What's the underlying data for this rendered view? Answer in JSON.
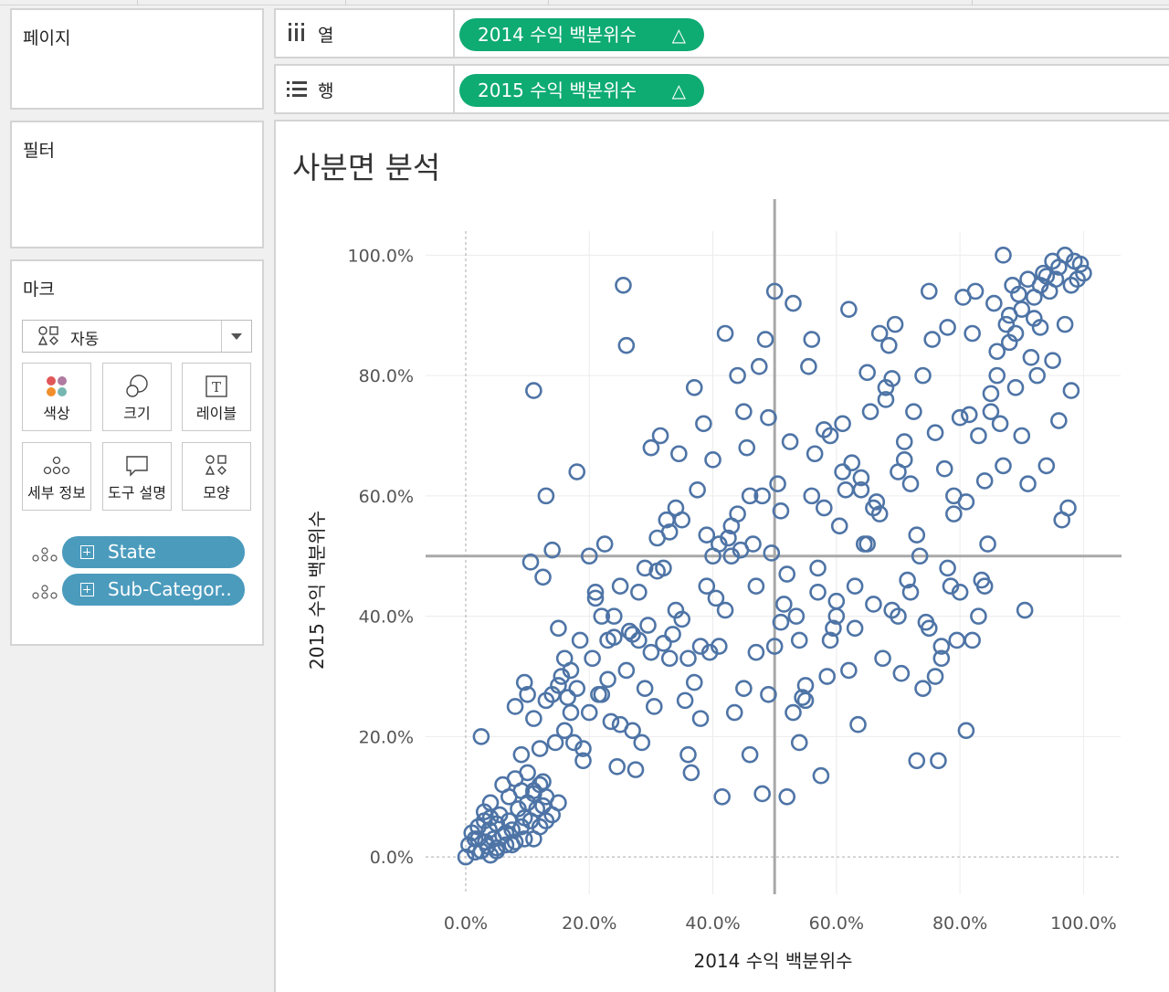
{
  "panels": {
    "pages": "페이지",
    "filters": "필터",
    "marks": "마크"
  },
  "marks": {
    "type_selected": "자동",
    "buttons": [
      "색상",
      "크기",
      "레이블",
      "세부 정보",
      "도구 설명",
      "모양"
    ],
    "fields": [
      "State",
      "Sub-Categor.."
    ]
  },
  "shelves": {
    "columns": {
      "label": "열",
      "pill": "2014 수익 백분위수",
      "delta": "△"
    },
    "rows": {
      "label": "행",
      "pill": "2015 수익 백분위수",
      "delta": "△"
    }
  },
  "colors": {
    "point": "#4e74a6",
    "pill_green": "#0eab73",
    "pill_blue": "#4b9bbd"
  },
  "chart_data": {
    "type": "scatter",
    "title": "사분면 분석",
    "xlabel": "2014 수익 백분위수",
    "ylabel": "2015 수익 백분위수",
    "xlim": [
      -6.5,
      106
    ],
    "ylim": [
      -6.2,
      104
    ],
    "xticks": [
      "0.0%",
      "20.0%",
      "40.0%",
      "60.0%",
      "80.0%",
      "100.0%"
    ],
    "yticks": [
      "0.0%",
      "20.0%",
      "40.0%",
      "60.0%",
      "80.0%",
      "100.0%"
    ],
    "reference_lines": {
      "x": 50,
      "y": 50
    },
    "marker": "open-circle",
    "grid": true,
    "points": [
      [
        0,
        0
      ],
      [
        0.5,
        2
      ],
      [
        1,
        4
      ],
      [
        1.5,
        3
      ],
      [
        2,
        5
      ],
      [
        2.5,
        1
      ],
      [
        3,
        6
      ],
      [
        3.2,
        2.5
      ],
      [
        3.8,
        4.5
      ],
      [
        4,
        0.3
      ],
      [
        4.5,
        3
      ],
      [
        5,
        5.5
      ],
      [
        5,
        1.5
      ],
      [
        5.5,
        7
      ],
      [
        6,
        3.5
      ],
      [
        6.5,
        2
      ],
      [
        7,
        6
      ],
      [
        7.5,
        4.5
      ],
      [
        8,
        2.5
      ],
      [
        8.5,
        8
      ],
      [
        9,
        5
      ],
      [
        9.5,
        3
      ],
      [
        10,
        9
      ],
      [
        10.5,
        6
      ],
      [
        11,
        11
      ],
      [
        11.5,
        8
      ],
      [
        12,
        5
      ],
      [
        12.5,
        12.5
      ],
      [
        13,
        10
      ],
      [
        14,
        7
      ],
      [
        15,
        9
      ],
      [
        5,
        1
      ],
      [
        2,
        3
      ],
      [
        3,
        7.5
      ],
      [
        4,
        9
      ],
      [
        6,
        12
      ],
      [
        7,
        10
      ],
      [
        8,
        13
      ],
      [
        9,
        11
      ],
      [
        10,
        14
      ],
      [
        11,
        10.5
      ],
      [
        12,
        12
      ],
      [
        12.5,
        8.5
      ],
      [
        13,
        6
      ],
      [
        2.5,
        20
      ],
      [
        4,
        6.5
      ],
      [
        6.5,
        4
      ],
      [
        7.5,
        2
      ],
      [
        9.5,
        6.5
      ],
      [
        11,
        3
      ],
      [
        1.5,
        0.8
      ],
      [
        3.5,
        1.8
      ],
      [
        9.5,
        29
      ],
      [
        10.5,
        49
      ],
      [
        11,
        77.5
      ],
      [
        12.5,
        46.5
      ],
      [
        13,
        60
      ],
      [
        14,
        27
      ],
      [
        14.5,
        19
      ],
      [
        15,
        28.5
      ],
      [
        15.5,
        30
      ],
      [
        16,
        21
      ],
      [
        16.5,
        26.5
      ],
      [
        17,
        31
      ],
      [
        17.5,
        19
      ],
      [
        18,
        28
      ],
      [
        18.5,
        36
      ],
      [
        19,
        18
      ],
      [
        20,
        24
      ],
      [
        20.5,
        33
      ],
      [
        21,
        44
      ],
      [
        21.5,
        27
      ],
      [
        22,
        40
      ],
      [
        22.5,
        52
      ],
      [
        23,
        29.5
      ],
      [
        23.5,
        22.5
      ],
      [
        24,
        36.5
      ],
      [
        24.5,
        15
      ],
      [
        25,
        45
      ],
      [
        25.5,
        95
      ],
      [
        26,
        85
      ],
      [
        26.5,
        37.5
      ],
      [
        27,
        37
      ],
      [
        27.5,
        14.5
      ],
      [
        28,
        44
      ],
      [
        28.5,
        19
      ],
      [
        29,
        28
      ],
      [
        29.5,
        38.5
      ],
      [
        30,
        68
      ],
      [
        30.5,
        25
      ],
      [
        31,
        47.5
      ],
      [
        31.5,
        70
      ],
      [
        32,
        35.5
      ],
      [
        32.5,
        56
      ],
      [
        33,
        33
      ],
      [
        33.5,
        37
      ],
      [
        34,
        58
      ],
      [
        34.5,
        67
      ],
      [
        35,
        39.5
      ],
      [
        35.5,
        26
      ],
      [
        36,
        33
      ],
      [
        36.5,
        14
      ],
      [
        37,
        78
      ],
      [
        37.5,
        61
      ],
      [
        38,
        23
      ],
      [
        38.5,
        72
      ],
      [
        39,
        53.5
      ],
      [
        39.5,
        34
      ],
      [
        40,
        66
      ],
      [
        40.5,
        43
      ],
      [
        41,
        35
      ],
      [
        41.5,
        10
      ],
      [
        42,
        87
      ],
      [
        42.5,
        53
      ],
      [
        43,
        55
      ],
      [
        43.5,
        24
      ],
      [
        44,
        80
      ],
      [
        44.5,
        51
      ],
      [
        45,
        74
      ],
      [
        45.5,
        68
      ],
      [
        46,
        60
      ],
      [
        46.5,
        52
      ],
      [
        47,
        34
      ],
      [
        47.5,
        81.5
      ],
      [
        48,
        10.5
      ],
      [
        48.5,
        86
      ],
      [
        49,
        73
      ],
      [
        49.5,
        50.5
      ],
      [
        50,
        94
      ],
      [
        50.5,
        62
      ],
      [
        51,
        57.5
      ],
      [
        51.5,
        42
      ],
      [
        52,
        47
      ],
      [
        52.5,
        69
      ],
      [
        53,
        92
      ],
      [
        53.5,
        40
      ],
      [
        54,
        36
      ],
      [
        54.5,
        26.5
      ],
      [
        55,
        28.5
      ],
      [
        55.5,
        81.5
      ],
      [
        56,
        60
      ],
      [
        56.5,
        67
      ],
      [
        57,
        44
      ],
      [
        57.5,
        13.5
      ],
      [
        58,
        71
      ],
      [
        58.5,
        30
      ],
      [
        59,
        70
      ],
      [
        59.5,
        38
      ],
      [
        60,
        42.5
      ],
      [
        60.5,
        55
      ],
      [
        61,
        72
      ],
      [
        61.5,
        61
      ],
      [
        62,
        91
      ],
      [
        62.5,
        65.5
      ],
      [
        63,
        45
      ],
      [
        63.5,
        22
      ],
      [
        64,
        63
      ],
      [
        64.5,
        52
      ],
      [
        65,
        80.5
      ],
      [
        65.5,
        74
      ],
      [
        66,
        42
      ],
      [
        66.5,
        59
      ],
      [
        67,
        57
      ],
      [
        67.5,
        33
      ],
      [
        68,
        76
      ],
      [
        68.5,
        85
      ],
      [
        69,
        79.5
      ],
      [
        69.5,
        88.5
      ],
      [
        70,
        64
      ],
      [
        70.5,
        30.5
      ],
      [
        71,
        69
      ],
      [
        71.5,
        46
      ],
      [
        72,
        62
      ],
      [
        72.5,
        74
      ],
      [
        73,
        53.5
      ],
      [
        73.5,
        50
      ],
      [
        74,
        80
      ],
      [
        74.5,
        39
      ],
      [
        75,
        94
      ],
      [
        75.5,
        86
      ],
      [
        76,
        70.5
      ],
      [
        76.5,
        16
      ],
      [
        77,
        35
      ],
      [
        77.5,
        64.5
      ],
      [
        78,
        88
      ],
      [
        78.5,
        45
      ],
      [
        79,
        57
      ],
      [
        79.5,
        36
      ],
      [
        80,
        73
      ],
      [
        80.5,
        93
      ],
      [
        81,
        59
      ],
      [
        81.5,
        73.5
      ],
      [
        82,
        87
      ],
      [
        82.5,
        94
      ],
      [
        83,
        70
      ],
      [
        83.5,
        46
      ],
      [
        84,
        62.5
      ],
      [
        84.5,
        52
      ],
      [
        85,
        77
      ],
      [
        85.5,
        92
      ],
      [
        86,
        84
      ],
      [
        86.5,
        72
      ],
      [
        87,
        65
      ],
      [
        87.5,
        88.5
      ],
      [
        88,
        85.5
      ],
      [
        88.5,
        95
      ],
      [
        89,
        78
      ],
      [
        89.5,
        93.5
      ],
      [
        90,
        70
      ],
      [
        90.5,
        41
      ],
      [
        91,
        62
      ],
      [
        91.5,
        83
      ],
      [
        92,
        89.5
      ],
      [
        92.5,
        80
      ],
      [
        93,
        88
      ],
      [
        93.5,
        97
      ],
      [
        94,
        65
      ],
      [
        94.5,
        94
      ],
      [
        95,
        82.5
      ],
      [
        95.5,
        96
      ],
      [
        96,
        72.5
      ],
      [
        96.5,
        56
      ],
      [
        97,
        88.5
      ],
      [
        97.5,
        58
      ],
      [
        98,
        77.5
      ],
      [
        98.5,
        99
      ],
      [
        99,
        96
      ],
      [
        99.5,
        98.5
      ],
      [
        100,
        97
      ],
      [
        97,
        100
      ],
      [
        96,
        98
      ],
      [
        98,
        95
      ],
      [
        95,
        99
      ],
      [
        94,
        96.5
      ],
      [
        93,
        95
      ],
      [
        92,
        93
      ],
      [
        91,
        96
      ],
      [
        90,
        91
      ],
      [
        89,
        87
      ],
      [
        88,
        90
      ],
      [
        87,
        100
      ],
      [
        86,
        80
      ],
      [
        85,
        74
      ],
      [
        84,
        45
      ],
      [
        83,
        40
      ],
      [
        82,
        36
      ],
      [
        81,
        21
      ],
      [
        80,
        44
      ],
      [
        79,
        60
      ],
      [
        78,
        48
      ],
      [
        77,
        33
      ],
      [
        76,
        30
      ],
      [
        75,
        38
      ],
      [
        74,
        28
      ],
      [
        73,
        16
      ],
      [
        72,
        44
      ],
      [
        71,
        66
      ],
      [
        70,
        40
      ],
      [
        69,
        41
      ],
      [
        68,
        78
      ],
      [
        67,
        87
      ],
      [
        66,
        58
      ],
      [
        65,
        52
      ],
      [
        64,
        61
      ],
      [
        63,
        38
      ],
      [
        62,
        31
      ],
      [
        61,
        64
      ],
      [
        60,
        40
      ],
      [
        59,
        36
      ],
      [
        58,
        58
      ],
      [
        57,
        48
      ],
      [
        56,
        86
      ],
      [
        55,
        26
      ],
      [
        54,
        19
      ],
      [
        53,
        24
      ],
      [
        52,
        10
      ],
      [
        51,
        39
      ],
      [
        50,
        35
      ],
      [
        49,
        27
      ],
      [
        48,
        60
      ],
      [
        47,
        45
      ],
      [
        46,
        17
      ],
      [
        45,
        28
      ],
      [
        44,
        57
      ],
      [
        43,
        50
      ],
      [
        42,
        41
      ],
      [
        41,
        52
      ],
      [
        40,
        50
      ],
      [
        39,
        45
      ],
      [
        38,
        35
      ],
      [
        37,
        29
      ],
      [
        36,
        17
      ],
      [
        35,
        56
      ],
      [
        34,
        41
      ],
      [
        33,
        54
      ],
      [
        32,
        48
      ],
      [
        31,
        53
      ],
      [
        30,
        34
      ],
      [
        29,
        48
      ],
      [
        28,
        36
      ],
      [
        27,
        21
      ],
      [
        26,
        31
      ],
      [
        25,
        22
      ],
      [
        24,
        40
      ],
      [
        23,
        36
      ],
      [
        22,
        27
      ],
      [
        21,
        43
      ],
      [
        20,
        50
      ],
      [
        19,
        16
      ],
      [
        18,
        64
      ],
      [
        17,
        24
      ],
      [
        16,
        33
      ],
      [
        15,
        38
      ],
      [
        14,
        51
      ],
      [
        13,
        26
      ],
      [
        12,
        18
      ],
      [
        11,
        23
      ],
      [
        10,
        27
      ],
      [
        9,
        17
      ],
      [
        8,
        25
      ]
    ]
  }
}
